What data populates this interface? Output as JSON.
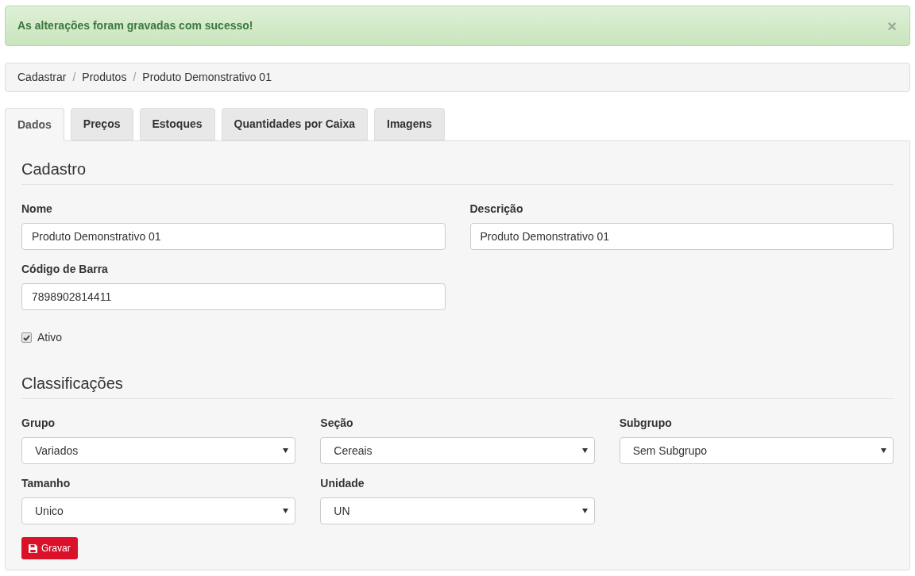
{
  "alert": {
    "message": "As alterações foram gravadas com sucesso!",
    "close": "×"
  },
  "breadcrumb": [
    "Cadastrar",
    "Produtos",
    "Produto Demonstrativo 01"
  ],
  "breadcrumb_separator": "/",
  "tabs": [
    {
      "label": "Dados",
      "selected": true
    },
    {
      "label": "Preços",
      "selected": false
    },
    {
      "label": "Estoques",
      "selected": false
    },
    {
      "label": "Quantidades por Caixa",
      "selected": false
    },
    {
      "label": "Imagens",
      "selected": false
    }
  ],
  "cadastro": {
    "heading": "Cadastro",
    "fields": [
      {
        "label": "Nome",
        "value": "Produto Demonstrativo 01"
      },
      {
        "label": "Descrição",
        "value": "Produto Demonstrativo 01"
      },
      {
        "label": "Código de Barra",
        "value": "7898902814411"
      }
    ],
    "checkbox": {
      "label": "Ativo",
      "checked": true
    }
  },
  "classificacoes": {
    "heading": "Classificações",
    "selects": [
      {
        "label": "Grupo",
        "value": "Variados"
      },
      {
        "label": "Seção",
        "value": "Cereais"
      },
      {
        "label": "Subgrupo",
        "value": "Sem Subgrupo"
      },
      {
        "label": "Tamanho",
        "value": "Unico"
      },
      {
        "label": "Unidade",
        "value": "UN"
      }
    ]
  },
  "save_button": {
    "label": "Gravar"
  }
}
